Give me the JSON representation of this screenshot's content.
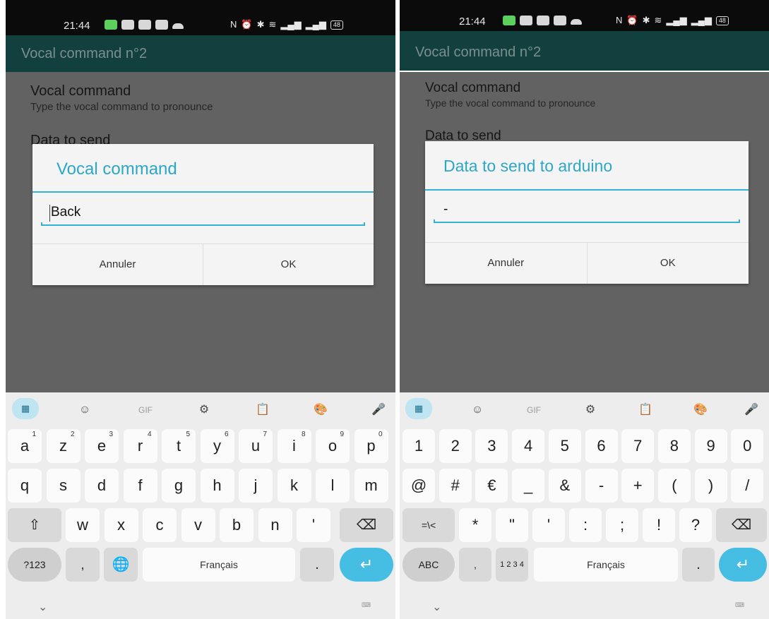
{
  "status_bar": {
    "time": "21:44",
    "battery": "48"
  },
  "left": {
    "appbar_title": "Vocal command n°2",
    "pref_title": "Vocal command",
    "pref_summary": "Type the vocal command to pronounce",
    "pref2_title": "Data to send",
    "dialog": {
      "title": "Vocal command",
      "input_value": "Back",
      "cancel_label": "Annuler",
      "ok_label": "OK"
    },
    "keyboard": {
      "row1": [
        {
          "k": "a",
          "h": "1"
        },
        {
          "k": "z",
          "h": "2"
        },
        {
          "k": "e",
          "h": "3"
        },
        {
          "k": "r",
          "h": "4"
        },
        {
          "k": "t",
          "h": "5"
        },
        {
          "k": "y",
          "h": "6"
        },
        {
          "k": "u",
          "h": "7"
        },
        {
          "k": "i",
          "h": "8"
        },
        {
          "k": "o",
          "h": "9"
        },
        {
          "k": "p",
          "h": "0"
        }
      ],
      "row2": [
        "q",
        "s",
        "d",
        "f",
        "g",
        "h",
        "j",
        "k",
        "l",
        "m"
      ],
      "row3": [
        "w",
        "x",
        "c",
        "v",
        "b",
        "n",
        "'"
      ],
      "mode_label": "?123",
      "emoji_comma": ",",
      "space_label": "Français",
      "period_label": "."
    }
  },
  "right": {
    "appbar_title": "Vocal command n°2",
    "pref_title": "Vocal command",
    "pref_summary": "Type the vocal command to pronounce",
    "pref2_title": "Data to send",
    "dialog": {
      "title": "Data to send to arduino",
      "input_value": "-",
      "cancel_label": "Annuler",
      "ok_label": "OK"
    },
    "keyboard": {
      "row1": [
        "1",
        "2",
        "3",
        "4",
        "5",
        "6",
        "7",
        "8",
        "9",
        "0"
      ],
      "row2": [
        "@",
        "#",
        "€",
        "_",
        "&",
        "-",
        "+",
        "(",
        ")",
        "/"
      ],
      "row3_first": "=\\<",
      "row3": [
        "*",
        "\"",
        "'",
        ":",
        ";",
        "!",
        "?"
      ],
      "mode_label": "ABC",
      "comma_label": ",",
      "numpad_label": "1 2 3 4",
      "space_label": "Français",
      "period_label": "."
    }
  },
  "icons": {
    "toolbar": [
      "apps-grid-icon",
      "sticker-icon",
      "gif-icon",
      "settings-icon",
      "clipboard-icon",
      "theme-palette-icon",
      "microphone-icon"
    ],
    "gif_label": "GIF"
  }
}
